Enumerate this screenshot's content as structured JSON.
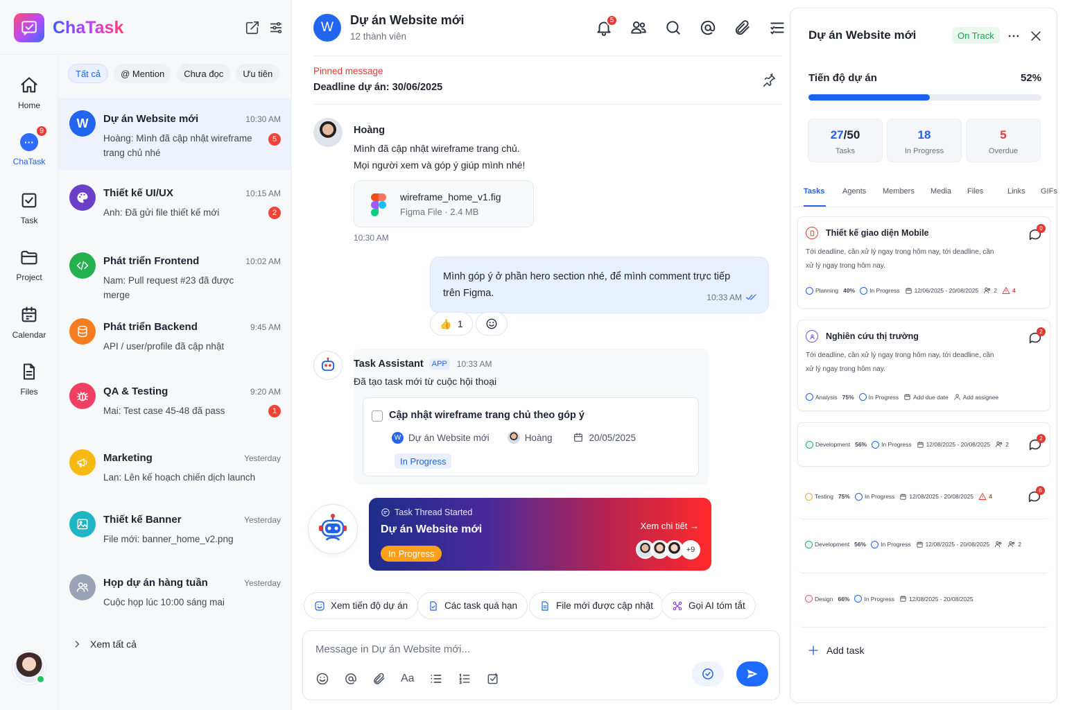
{
  "app": {
    "name": "ChaTask"
  },
  "rail": [
    {
      "label": "Home",
      "icon": "home-icon"
    },
    {
      "label": "ChaTask",
      "icon": "chat-icon",
      "badge": "9"
    },
    {
      "label": "Task",
      "icon": "task-icon"
    },
    {
      "label": "Project",
      "icon": "project-icon"
    },
    {
      "label": "Calendar",
      "icon": "calendar-icon"
    },
    {
      "label": "Files",
      "icon": "files-icon"
    }
  ],
  "filters": [
    "Tất cả",
    "@ Mention",
    "Chưa đọc",
    "Ưu tiên"
  ],
  "conversations": [
    {
      "title": "Dự án Website mới",
      "time": "10:30 AM",
      "preview": "Hoàng: Mình đã cập nhật wireframe trang chủ nhé",
      "badge": "5",
      "avatar_letter": "W",
      "color": "#2266ee"
    },
    {
      "title": "Thiết kế UI/UX",
      "time": "10:15 AM",
      "preview": "Anh: Đã gửi file thiết kế mới",
      "badge": "2",
      "color": "#6b3fc7"
    },
    {
      "title": "Phát triển Frontend",
      "time": "10:02 AM",
      "preview": "Nam: Pull request #23 đã được merge",
      "badge": "",
      "color": "#22b14c"
    },
    {
      "title": "Phát triển Backend",
      "time": "9:45 AM",
      "preview": "API / user/profile đã cập nhật",
      "badge": "",
      "color": "#f57c1f"
    },
    {
      "title": "QA & Testing",
      "time": "9:20 AM",
      "preview": "Mai: Test case 45-48 đã pass",
      "badge": "1",
      "color": "#ef3f63"
    },
    {
      "title": "Marketing",
      "time": "Yesterday",
      "preview": "Lan: Lên kế hoạch chiến dịch launch",
      "badge": "",
      "color": "#f5b90f"
    },
    {
      "title": "Thiết kế Banner",
      "time": "Yesterday",
      "preview": "File mới: banner_home_v2.png",
      "badge": "",
      "color": "#1fb5c4"
    },
    {
      "title": "Họp dự án hàng tuần",
      "time": "Yesterday",
      "preview": "Cuộc họp lúc 10:00 sáng mai",
      "badge": "",
      "color": "#9aa3b5"
    }
  ],
  "see_all": "Xem tất cả",
  "chat": {
    "title": "Dự án Website mới",
    "avatar_letter": "W",
    "members": "12 thành viên",
    "notif_badge": "5",
    "pinned_label": "Pinned message",
    "pinned_text": "Deadline dự án: 30/06/2025",
    "msg1": {
      "sender": "Hoàng",
      "line1": "Mình đã cập nhật wireframe trang chủ.",
      "line2": "Mọi người xem và góp ý giúp mình nhé!",
      "file_name": "wireframe_home_v1.fig",
      "file_meta": "Figma File · 2.4 MB",
      "time": "10:30 AM"
    },
    "msg2": {
      "text": "Mình góp ý ở phần hero section nhé, để mình comment trực tiếp trên Figma.",
      "time": "10:33 AM",
      "reaction": "👍",
      "reaction_count": "1"
    },
    "assistant": {
      "name": "Task Assistant",
      "tag": "APP",
      "time": "10:33 AM",
      "text": "Đã tạo task mới từ cuộc hội thoại",
      "task_title": "Cập nhật wireframe trang chủ theo góp ý",
      "project": "Dự án Website mới",
      "project_letter": "W",
      "assignee": "Hoàng",
      "date": "20/05/2025",
      "status": "In Progress"
    },
    "thread": {
      "label": "Task Thread Started",
      "title": "Dự án Website mới",
      "status": "In Progress",
      "link": "Xem chi tiết →",
      "more": "+9"
    },
    "quick_actions": [
      "Xem tiến độ dự án",
      "Các task quá hạn",
      "File mới được cập nhật",
      "Gọi AI tóm tắt"
    ],
    "composer_placeholder": "Message in Dự án Website mới...",
    "font_tool": "Aa"
  },
  "panel": {
    "title": "Dự án Website mới",
    "status": "On Track",
    "progress_label": "Tiến độ dự án",
    "progress_pct": "52%",
    "progress_value": 0.52,
    "stats": [
      {
        "value": "27",
        "total": "/50",
        "label": "Tasks"
      },
      {
        "value": "18",
        "total": "",
        "label": "In Progress"
      },
      {
        "value": "5",
        "total": "",
        "label": "Overdue"
      }
    ],
    "tabs": [
      "Tasks",
      "Agents",
      "Members",
      "Media",
      "Files",
      "Links",
      "GIFs"
    ],
    "tasks": [
      {
        "title": "Thiết kế giao diện Mobile",
        "desc": "Tới deadline, cần xử lý ngay trong hôm nay, tới deadline, cần xử lý ngay trong hôm nay.",
        "comments": "0",
        "category": "Planning",
        "pct": "40%",
        "status": "In Progress",
        "dates": "12/06/2025 - 20/08/2025",
        "people": "2",
        "warn": "4",
        "color": "#e53935"
      },
      {
        "title": "Nghiên cứu thị trường",
        "desc": "Tới deadline, cần xử lý ngay trong hôm nay, tới deadline, cần xử lý ngay trong hôm nay.",
        "comments": "2",
        "category": "Analysis",
        "pct": "75%",
        "status": "In Progress",
        "due": "Add due date",
        "assignee": "Add assignee",
        "color": "#7c4ddb"
      },
      {
        "category": "Development",
        "pct": "56%",
        "status": "In Progress",
        "dates": "12/08/2025 - 20/08/2025",
        "people": "2",
        "comments": "2",
        "color": "#22b14c"
      },
      {
        "category": "Testing",
        "pct": "75%",
        "status": "In Progress",
        "dates": "12/08/2025 - 20/08/2025",
        "warn": "4",
        "comments": "6",
        "color": "#f5a623"
      },
      {
        "category": "Development",
        "pct": "56%",
        "status": "In Progress",
        "dates": "12/08/2025 - 20/08/2025",
        "people": "2",
        "color": "#22b14c"
      },
      {
        "category": "Design",
        "pct": "66%",
        "status": "In Progress",
        "dates": "12/08/2025 - 20/08/2025",
        "color": "#e8579b"
      }
    ],
    "add_task": "Add task"
  }
}
